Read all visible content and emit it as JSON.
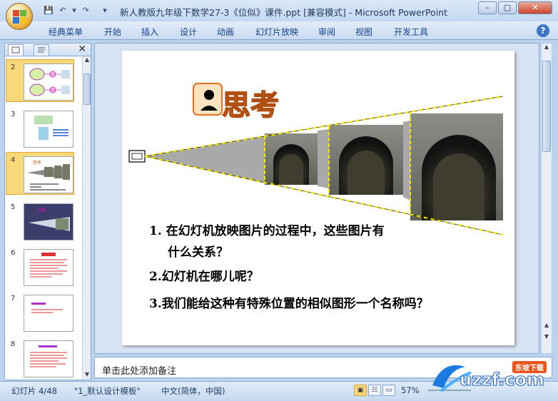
{
  "window": {
    "title": "新人教版九年级下数学27-3《位似》课件.ppt [兼容模式] - Microsoft PowerPoint"
  },
  "ribbon": {
    "tabs": [
      "经典菜单",
      "开始",
      "插入",
      "设计",
      "动画",
      "幻灯片放映",
      "审阅",
      "视图",
      "开发工具"
    ]
  },
  "slides_panel": {
    "numbers": [
      "2",
      "3",
      "4",
      "5",
      "6",
      "7",
      "8"
    ],
    "selected": "4"
  },
  "slide": {
    "heading": "思考",
    "q1_line1": "1.  在幻灯机放映图片的过程中，这些图片有",
    "q1_line2": "什么关系？",
    "q2": "2.幻灯机在哪儿呢？",
    "q3": "3.我们能给这种有特殊位置的相似图形一个名称吗？"
  },
  "notes": {
    "placeholder": "单击此处添加备注"
  },
  "status": {
    "slide_counter": "幻灯片 4/48",
    "theme": "\"1_默认设计模板\"",
    "language": "中文(简体，中国)",
    "zoom": "57%"
  },
  "watermark": {
    "text": "uzzf.com",
    "badge": "东坡下载"
  },
  "colors": {
    "accent": "#f0a040",
    "ribbon_text": "#15428b",
    "dash_yellow": "#f2e600"
  }
}
